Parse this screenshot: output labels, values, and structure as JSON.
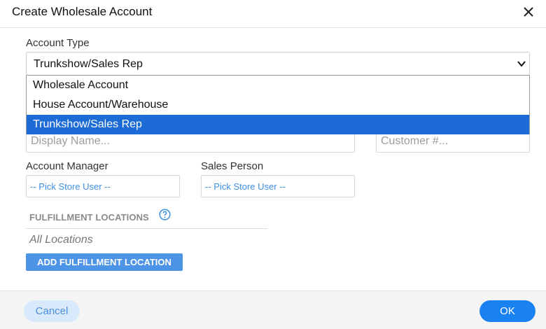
{
  "dialog": {
    "title": "Create Wholesale Account",
    "close_icon": "close-icon"
  },
  "account_type": {
    "label": "Account Type",
    "selected": "Trunkshow/Sales Rep",
    "options": [
      "Wholesale Account",
      "House Account/Warehouse",
      "Trunkshow/Sales Rep"
    ],
    "highlighted_index": 2
  },
  "display_name": {
    "placeholder": "Display Name..."
  },
  "customer_number": {
    "placeholder": "Customer #..."
  },
  "account_manager": {
    "label": "Account Manager",
    "placeholder": "-- Pick Store User --"
  },
  "sales_person": {
    "label": "Sales Person",
    "placeholder": "-- Pick Store User --"
  },
  "fulfillment": {
    "title": "FULFILLMENT LOCATIONS",
    "help_icon": "help-circle-icon",
    "empty_text": "All Locations",
    "add_button": "ADD FULFILLMENT LOCATION"
  },
  "footer": {
    "cancel": "Cancel",
    "ok": "OK"
  },
  "colors": {
    "highlight": "#1c6bd6",
    "primary": "#1a82f0",
    "secondary_bg": "#d8e9fb",
    "link": "#3d8fe0"
  }
}
